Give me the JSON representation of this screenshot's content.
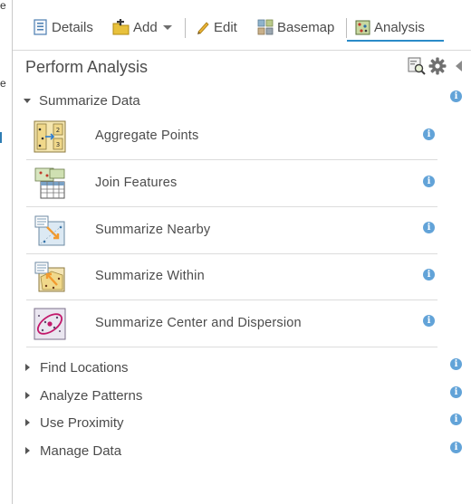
{
  "toolbar": {
    "details_label": "Details",
    "add_label": "Add",
    "edit_label": "Edit",
    "basemap_label": "Basemap",
    "analysis_label": "Analysis",
    "active_tab": "Analysis"
  },
  "panel": {
    "title": "Perform Analysis",
    "info_glyph": "i"
  },
  "sections": {
    "summarize": {
      "label": "Summarize Data",
      "expanded": true,
      "tools": [
        {
          "label": "Aggregate Points",
          "icon": "aggregate-points-icon"
        },
        {
          "label": "Join Features",
          "icon": "join-features-icon"
        },
        {
          "label": "Summarize Nearby",
          "icon": "summarize-nearby-icon"
        },
        {
          "label": "Summarize Within",
          "icon": "summarize-within-icon"
        },
        {
          "label": "Summarize Center and Dispersion",
          "icon": "summarize-center-dispersion-icon"
        }
      ]
    },
    "collapsed": [
      {
        "label": "Find Locations"
      },
      {
        "label": "Analyze Patterns"
      },
      {
        "label": "Use Proximity"
      },
      {
        "label": "Manage Data"
      }
    ]
  },
  "left_edge": {
    "glyph_top": "e",
    "glyph_mid": "e"
  },
  "colors": {
    "accent": "#2a8bc8",
    "info": "#62a3d8",
    "text": "#4c4c4c",
    "divider": "#dcdcdc"
  }
}
